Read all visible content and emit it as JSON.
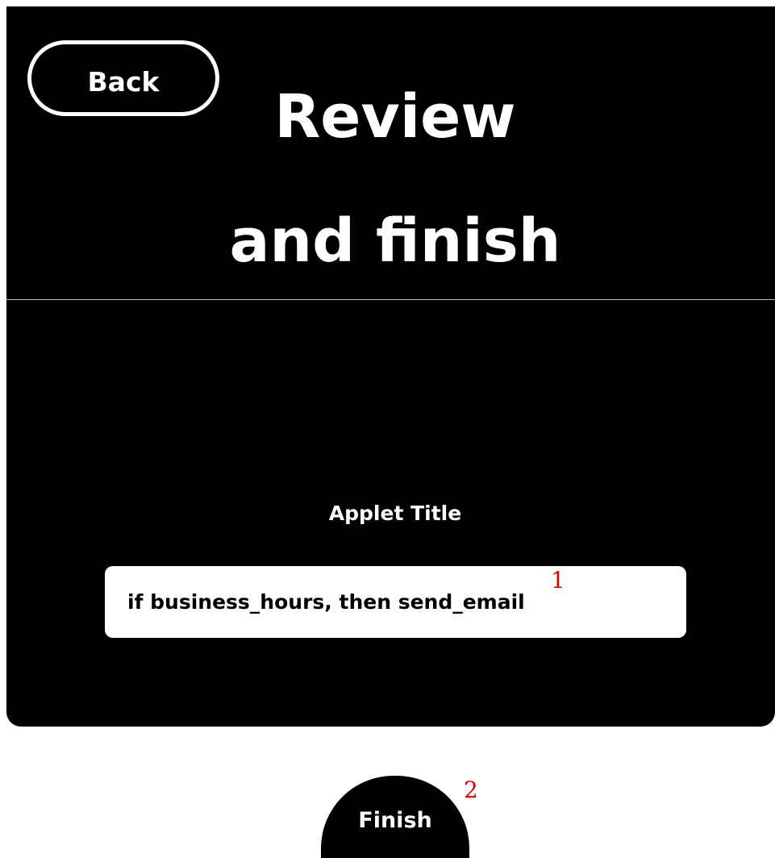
{
  "header": {
    "back_label": "Back",
    "title_line_1": "Review",
    "title_line_2": "and finish"
  },
  "form": {
    "applet_title_label": "Applet Title",
    "applet_title_value": "if business_hours, then send_email"
  },
  "footer": {
    "finish_label": "Finish"
  },
  "markers": {
    "one": "1",
    "two": "2"
  },
  "colors": {
    "background": "#000000",
    "text": "#ffffff",
    "marker": "#e00000"
  }
}
